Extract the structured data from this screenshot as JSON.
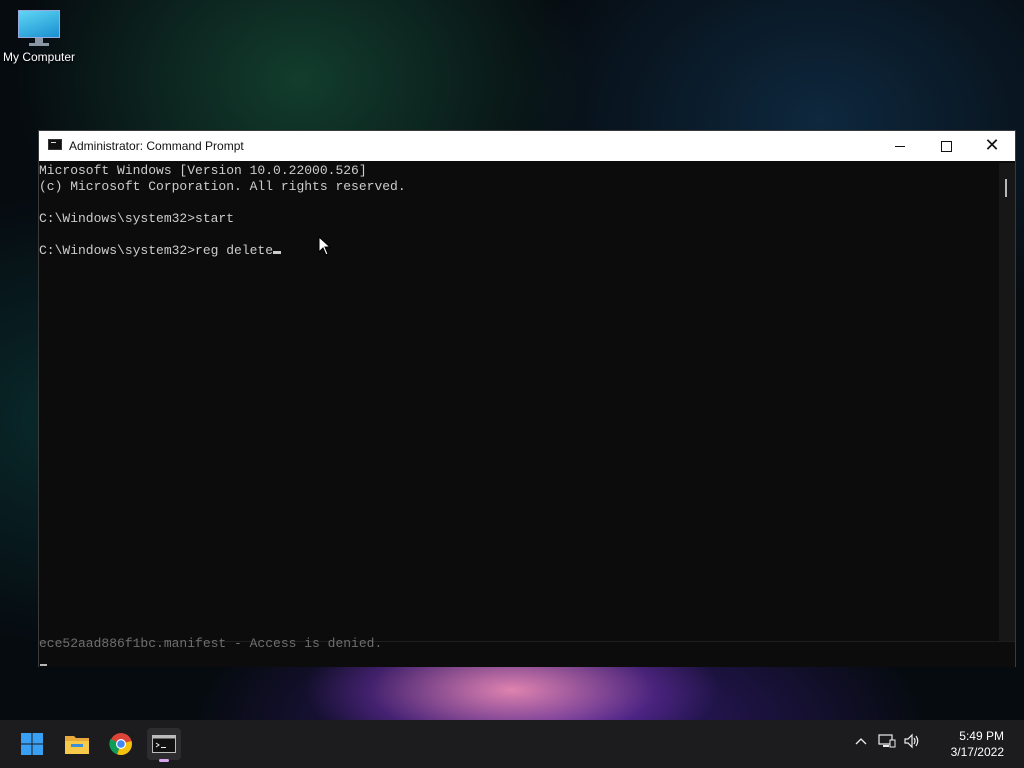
{
  "desktop": {
    "icons": [
      {
        "label": "My Computer",
        "icon": "monitor-icon"
      }
    ]
  },
  "window": {
    "title": "Administrator: Command Prompt",
    "controls": {
      "minimize": "minimize-icon",
      "maximize": "maximize-icon",
      "close": "close-icon"
    },
    "console": {
      "lines": [
        "Microsoft Windows [Version 10.0.22000.526]",
        "(c) Microsoft Corporation. All rights reserved.",
        "",
        "C:\\Windows\\system32>start",
        "",
        "C:\\Windows\\system32>reg delete"
      ],
      "lower_pane_text": "ece52aad886f1bc.manifest - Access is denied."
    }
  },
  "taskbar": {
    "items": [
      "start-icon",
      "file-explorer-icon",
      "chrome-icon",
      "command-prompt-icon"
    ],
    "tray": {
      "icons": [
        "chevron-up-icon",
        "network-icon",
        "volume-icon"
      ],
      "time": "5:49 PM",
      "date": "3/17/2022"
    }
  },
  "colors": {
    "taskbar_bg": "#1c1c1e",
    "console_bg": "#0c0c0c",
    "console_text": "#cccccc",
    "active_indicator": "#d8a6f0"
  }
}
